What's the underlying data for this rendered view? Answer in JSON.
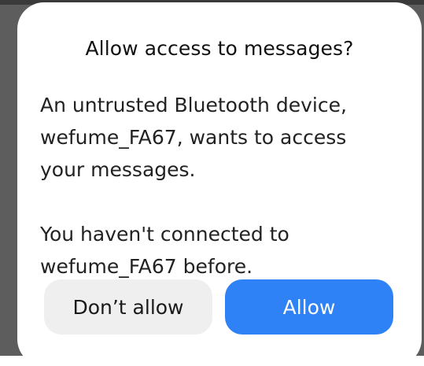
{
  "dialog": {
    "title": "Allow access to messages?",
    "message": "An untrusted Bluetooth device,\nwefume_FA67, wants to access\nyour messages.\n\nYou haven't connected to\nwefume_FA67 before.",
    "deny_label": "Don’t allow",
    "allow_label": "Allow"
  },
  "colors": {
    "accent": "#2f82f5",
    "secondary_button": "#efefef",
    "scrim": "#5d5d5d"
  }
}
